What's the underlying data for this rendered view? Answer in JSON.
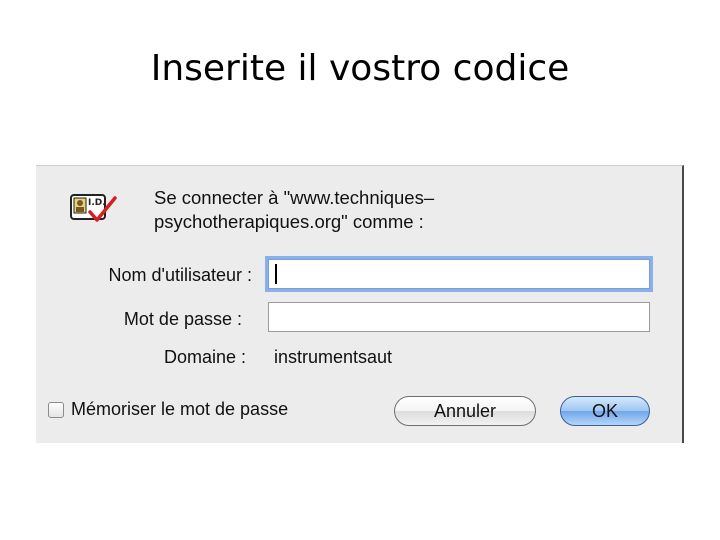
{
  "slide": {
    "title": "Inserite il vostro codice"
  },
  "dialog": {
    "icon": "id-card-check-icon",
    "prompt_line1": "Se connecter à \"www.techniques–",
    "prompt_line2": "psychotherapiques.org\" comme :",
    "username_label": "Nom d'utilisateur :",
    "username_value": "",
    "password_label": "Mot de passe :",
    "password_value": "",
    "domain_label": "Domaine :",
    "domain_value": "instrumentsaut",
    "remember_label": "Mémoriser le mot de passe",
    "remember_checked": false,
    "cancel_label": "Annuler",
    "ok_label": "OK"
  },
  "colors": {
    "focus_ring": "#88b0ec",
    "default_button": "#6fa6ea",
    "dialog_background": "#ececec"
  }
}
